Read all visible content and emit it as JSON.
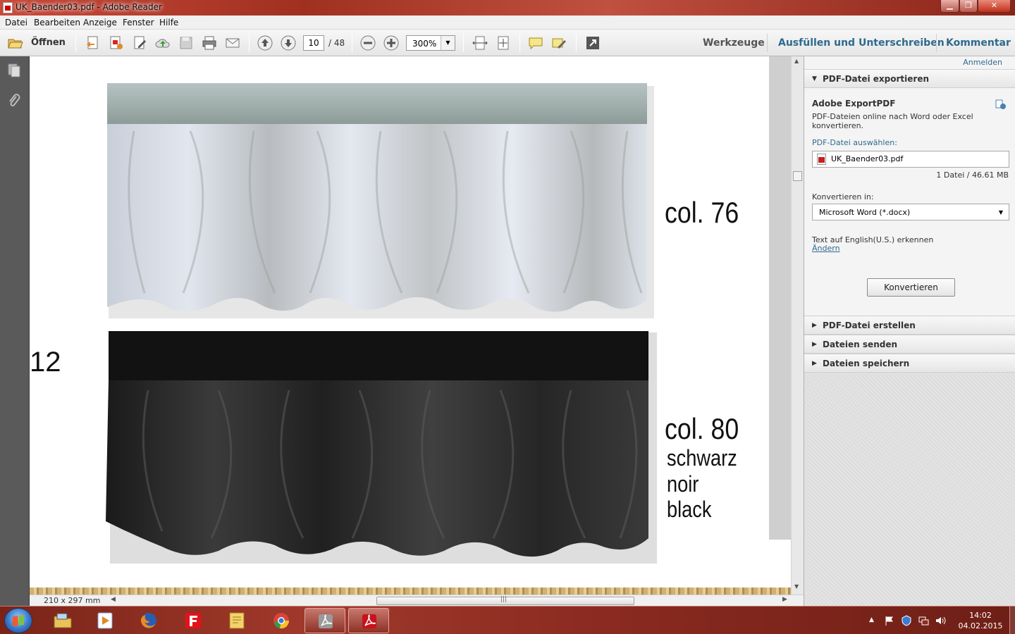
{
  "window": {
    "title": "UK_Baender03.pdf - Adobe Reader",
    "minimize_icon": "minimize-icon",
    "maximize_icon": "maximize-icon",
    "close_icon": "close-icon"
  },
  "menu": [
    "Datei",
    "Bearbeiten",
    "Anzeige",
    "Fenster",
    "Hilfe"
  ],
  "toolbar": {
    "open_label": "Öffnen",
    "current_page": "10",
    "total_pages": "/ 48",
    "zoom": "300%",
    "tabs": {
      "tools": "Werkzeuge",
      "fill_sign": "Ausfüllen und Unterschreiben",
      "comment": "Kommentar"
    }
  },
  "document": {
    "page_fragment": "12",
    "items": [
      {
        "label": "col. 76",
        "colors": []
      },
      {
        "label": "col. 80",
        "colors": [
          "schwarz",
          "noir",
          "black"
        ]
      }
    ],
    "page_size": "210 x 297 mm"
  },
  "right_panel": {
    "signin": "Anmelden",
    "export": {
      "header": "PDF-Datei exportieren",
      "service": "Adobe ExportPDF",
      "description": "PDF-Dateien online nach Word oder Excel konvertieren.",
      "select_label": "PDF-Datei auswählen:",
      "file_name": "UK_Baender03.pdf",
      "file_info": "1 Datei / 46.61 MB",
      "convert_to_label": "Konvertieren in:",
      "format": "Microsoft Word (*.docx)",
      "ocr_text": "Text auf English(U.S.) erkennen",
      "ocr_change": "Ändern",
      "convert_button": "Konvertieren"
    },
    "sections": [
      "PDF-Datei erstellen",
      "Dateien senden",
      "Dateien speichern"
    ]
  },
  "taskbar": {
    "apps": [
      "explorer-icon",
      "media-player-icon",
      "firefox-icon",
      "foxit-icon",
      "notes-icon",
      "chrome-icon",
      "acrobat-gray-icon",
      "adobe-reader-icon"
    ],
    "time": "14:02",
    "date": "04.02.2015"
  }
}
